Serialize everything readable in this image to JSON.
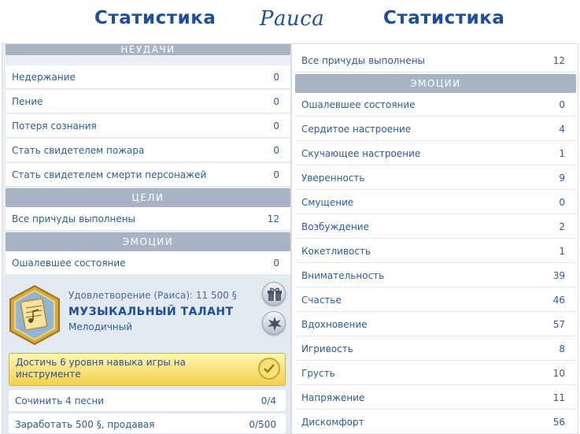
{
  "titles": {
    "left": "Статистика",
    "center": "Раиса",
    "right": "Статистика"
  },
  "left_panel": {
    "header_top": "Неудачи",
    "failures": [
      {
        "label": "Недержание",
        "value": "0"
      },
      {
        "label": "Пение",
        "value": "0"
      },
      {
        "label": "Потеря сознания",
        "value": "0"
      },
      {
        "label": "Стать свидетелем пожара",
        "value": "0"
      },
      {
        "label": "Стать свидетелем смерти персонажей",
        "value": "0"
      }
    ],
    "goals_header": "Цели",
    "goals": [
      {
        "label": "Все причуды выполнены",
        "value": "12"
      }
    ],
    "emotions_header": "Эмоции",
    "emotions": [
      {
        "label": "Ошалевшее состояние",
        "value": "0"
      }
    ]
  },
  "aspiration": {
    "satisfaction": "Удовлетворение (Раиса): 11  500",
    "currency_symbol": "§",
    "name": "Музыкальный талант",
    "subtitle": "Мелодичный",
    "current_task": "Достичь 6 уровня навыка игры на инструменте",
    "tasks": [
      {
        "label": "Сочинить 4 песни",
        "value": "0/4"
      },
      {
        "label": "Заработать 500 §, продавая",
        "value": "0/500"
      }
    ]
  },
  "right_panel": {
    "goals": [
      {
        "label": "Все причуды выполнены",
        "value": "12"
      }
    ],
    "emotions_header": "Эмоции",
    "emotions": [
      {
        "label": "Ошалевшее состояние",
        "value": "0"
      },
      {
        "label": "Сердитое настроение",
        "value": "4"
      },
      {
        "label": "Скучающее настроение",
        "value": "1"
      },
      {
        "label": "Уверенность",
        "value": "9"
      },
      {
        "label": "Смущение",
        "value": "0"
      },
      {
        "label": "Возбуждение",
        "value": "2"
      },
      {
        "label": "Кокетливость",
        "value": "1"
      },
      {
        "label": "Внимательность",
        "value": "39"
      },
      {
        "label": "Счастье",
        "value": "46"
      },
      {
        "label": "Вдохновение",
        "value": "57"
      },
      {
        "label": "Игривость",
        "value": "8"
      },
      {
        "label": "Грусть",
        "value": "10"
      },
      {
        "label": "Напряжение",
        "value": "11"
      },
      {
        "label": "Дискомфорт",
        "value": "56"
      }
    ]
  },
  "icons": {
    "aspiration": "music-sheet-badge-icon",
    "gift": "gift-icon",
    "change": "sparkle-burst-icon",
    "check": "checkmark-icon"
  }
}
